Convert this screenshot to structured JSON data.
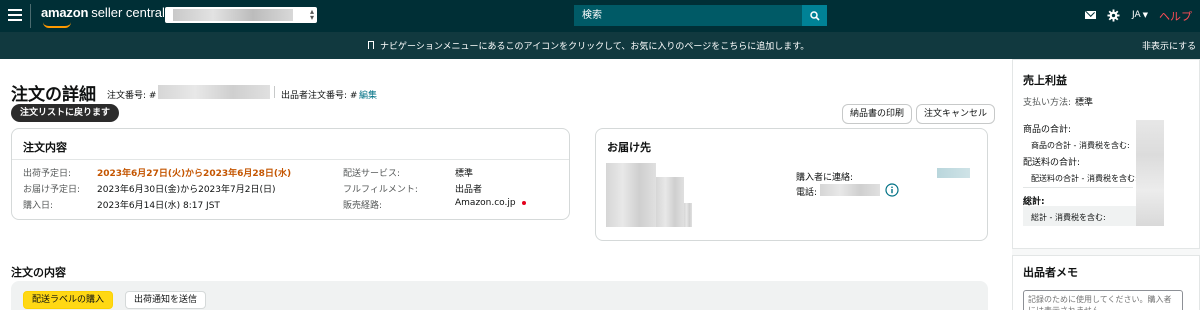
{
  "header": {
    "brand": "amazon",
    "product": "seller central",
    "search_placeholder": "検索",
    "language": "JA",
    "help": "ヘルプ"
  },
  "subbar": {
    "message": "ナビゲーションメニューにあるこのアイコンをクリックして、お気に入りのページをこちらに追加します。",
    "hide": "非表示にする"
  },
  "page": {
    "title": "注文の詳細",
    "order_number_label": "注文番号: #",
    "seller_order_label": "出品者注文番号: #",
    "edit_link": "編集",
    "back_button": "注文リストに戻ります",
    "print_button": "納品書の印刷",
    "cancel_button": "注文キャンセル"
  },
  "order_info": {
    "title": "注文内容",
    "rows": [
      {
        "label": "出荷予定日:",
        "value": "2023年6月27日(火)から2023年6月28日(水)"
      },
      {
        "label": "お届け予定日:",
        "value": "2023年6月30日(金)から2023年7月2日(日)"
      },
      {
        "label": "購入日:",
        "value": "2023年6月14日(水) 8:17 JST"
      }
    ],
    "rows2": [
      {
        "label": "配送サービス:",
        "value": "標準"
      },
      {
        "label": "フルフィルメント:",
        "value": "出品者"
      },
      {
        "label": "販売経路:",
        "value": "Amazon.co.jp"
      }
    ]
  },
  "ship_to": {
    "title": "お届け先",
    "contact_label": "購入者に連絡:",
    "phone_label": "電話:"
  },
  "items": {
    "title": "注文の内容",
    "buy_label_button": "配送ラベルの購入",
    "ship_confirm_button": "出荷通知を送信"
  },
  "sales": {
    "title": "売上利益",
    "payment_label": "支払い方法:",
    "payment_value": "標準",
    "item_total": "商品の合計:",
    "item_total_sub": "商品の合計 - 消費税を含む:",
    "shipping_total": "配送料の合計:",
    "shipping_total_sub": "配送料の合計 - 消費税を含む:",
    "total": "総計:",
    "total_sub": "総計 - 消費税を含む:"
  },
  "memo": {
    "title": "出品者メモ",
    "placeholder": "記録のために使用してください。購入者には表示されません"
  },
  "colors": {
    "nav_bg": "#002f36",
    "subbar_bg": "#11393f",
    "accent_orange": "#c45500",
    "link": "#007185",
    "help_red": "#ff4b55",
    "yellow_button": "#ffd814"
  }
}
